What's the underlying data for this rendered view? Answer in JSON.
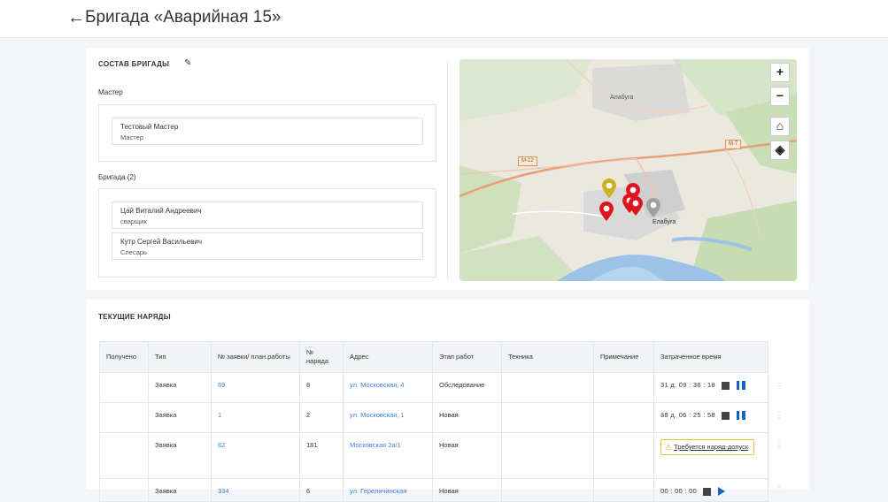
{
  "header": {
    "title": "Бригада «Аварийная 15»"
  },
  "composition": {
    "title": "СОСТАВ БРИГАДЫ",
    "master_label": "Мастер",
    "master": {
      "name": "Тестовый Мастер",
      "role": "Мастер"
    },
    "brigade_label": "Бригада (2)",
    "members": [
      {
        "name": "Цай Виталий Андреевич",
        "role": "сварщик"
      },
      {
        "name": "Кутр Сергей Васильевич",
        "role": "Слесарь"
      }
    ]
  },
  "map": {
    "labels": {
      "town_north": "Алабуга",
      "town_main": "Елабуга"
    },
    "roads": [
      "М-12",
      "М-7"
    ],
    "controls": {
      "zoom_in": "+",
      "zoom_out": "−",
      "home": "⌂",
      "layers": "◈"
    }
  },
  "orders": {
    "title": "ТЕКУЩИЕ НАРЯДЫ",
    "columns": [
      "Получено",
      "Тип",
      "№ заявки/ план.работы",
      "№ наряда",
      "Адрес",
      "Этап работ",
      "Техника",
      "Примечание",
      "Затраченное время"
    ],
    "rows": [
      {
        "received": "",
        "type": "Заявка",
        "request": "69",
        "order": "8",
        "address": "ул. Московская, 4",
        "stage": "Обследование",
        "equipment": "",
        "note": "",
        "time": "31 д. 09 : 36 : 18"
      },
      {
        "received": "",
        "type": "Заявка",
        "request": "1",
        "order": "2",
        "address": "ул. Московская, 1",
        "stage": "Новая",
        "equipment": "",
        "note": "",
        "time": "38 д. 06 : 25 : 58"
      },
      {
        "received": "",
        "type": "Заявка",
        "request": "62",
        "order": "181",
        "address": "Московская 2а/1",
        "stage": "Новая",
        "equipment": "",
        "note": "",
        "time": "",
        "warning": "Требуется наряд-допуск"
      },
      {
        "received": "",
        "type": "Заявка",
        "request": "334",
        "order": "6",
        "address": "ул. Гереличинская",
        "stage": "Новая",
        "equipment": "",
        "note": "",
        "time": "00 : 00 : 00"
      }
    ]
  },
  "colors": {
    "accent": "#1565c0",
    "link": "#3d7fd6",
    "marker_red": "#e0141e",
    "marker_yellow": "#c8b41e",
    "marker_grey": "#a0a0a0",
    "warning_border": "#e6c531"
  }
}
